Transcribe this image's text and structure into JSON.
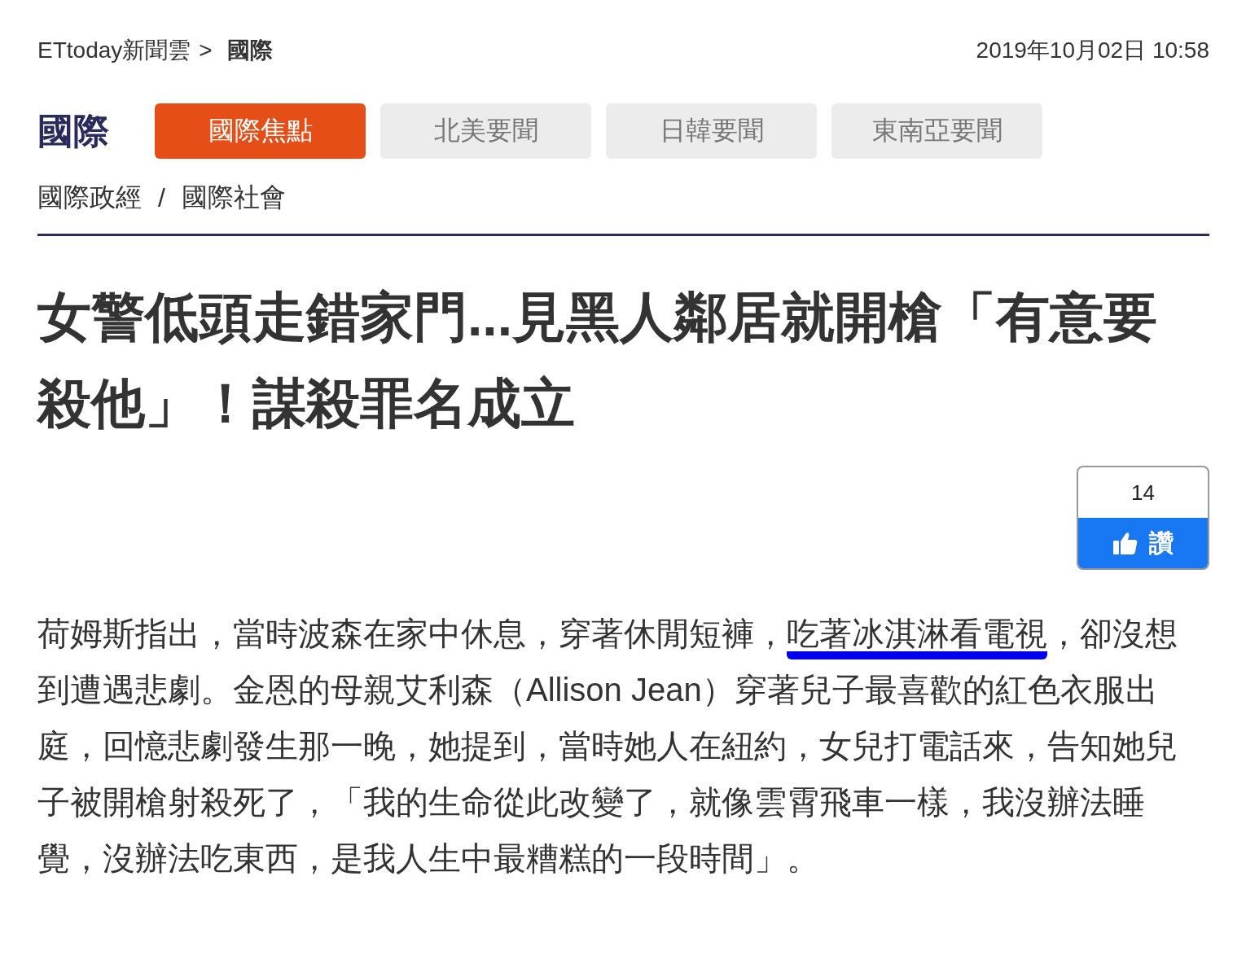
{
  "breadcrumb": {
    "site": "ETtoday新聞雲",
    "separator": ">",
    "current": "國際"
  },
  "date": "2019年10月02日 10:58",
  "section": {
    "title": "國際",
    "tabs": [
      {
        "label": "國際焦點",
        "selected": true
      },
      {
        "label": "北美要聞",
        "selected": false
      },
      {
        "label": "日韓要聞",
        "selected": false
      },
      {
        "label": "東南亞要聞",
        "selected": false
      }
    ],
    "sublinks": [
      "國際政經",
      "國際社會"
    ],
    "sublink_separator": "/"
  },
  "headline": "女警低頭走錯家門...見黑人鄰居就開槍「有意要殺他」！謀殺罪名成立",
  "like": {
    "count": "14",
    "label": "讚"
  },
  "paragraph": [
    {
      "text": "荷姆斯指出，當時波森在家中休息，穿著休閒短褲，",
      "underlined": false
    },
    {
      "text": "吃著冰淇淋看電視",
      "underlined": true
    },
    {
      "text": "，卻沒想到遭遇悲劇。金恩的母親艾利森（Allison Jean）穿著兒子最喜歡的紅色衣服出庭，回憶悲劇發生那一晚，她提到，當時她人在紐約，女兒打電話來，告知她兒子被開槍射殺死了，「我的生命從此改變了，就像雲霄飛車一樣，我沒辦法睡覺，沒辦法吃東西，是我人生中最糟糕的一段時間」。",
      "underlined": false
    }
  ]
}
